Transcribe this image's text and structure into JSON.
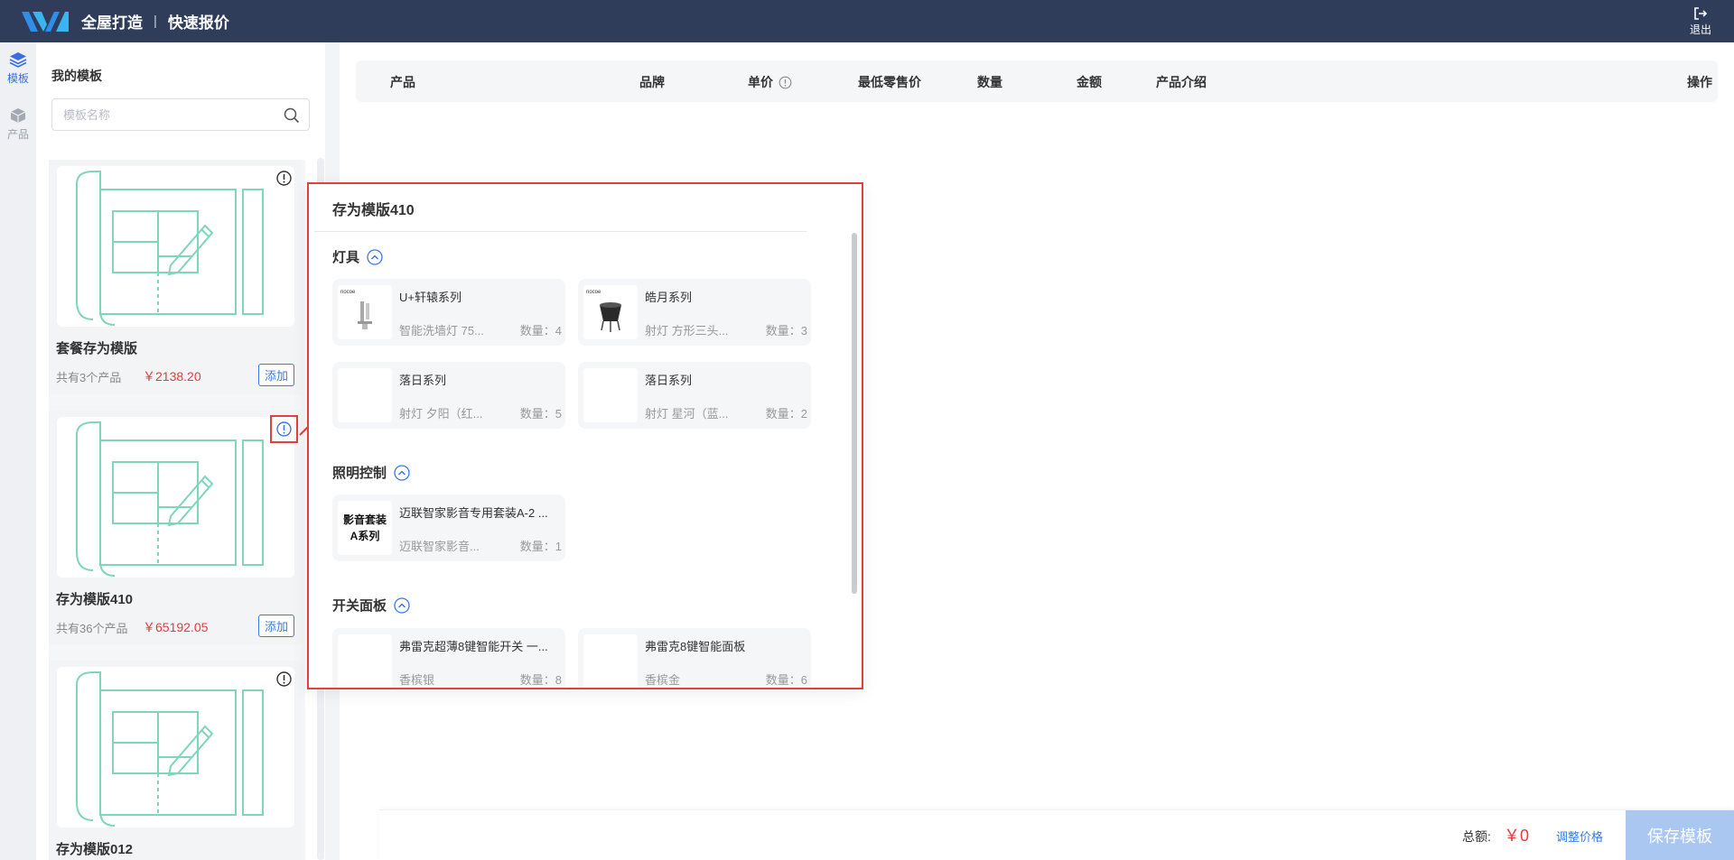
{
  "header": {
    "app_title": "全屋打造",
    "separator": "|",
    "subtitle": "快速报价",
    "logout_label": "退出"
  },
  "rail": {
    "items": [
      {
        "label": "模板",
        "icon": "layers-icon",
        "active": true
      },
      {
        "label": "产品",
        "icon": "box-icon",
        "active": false
      }
    ]
  },
  "templates": {
    "heading": "我的模板",
    "search_placeholder": "模板名称",
    "add_label": "添加",
    "items": [
      {
        "name": "套餐存为模版",
        "count": "共有3个产品",
        "price": "￥2138.20"
      },
      {
        "name": "存为模版410",
        "count": "共有36个产品",
        "price": "￥65192.05"
      },
      {
        "name": "存为模版012",
        "count": "",
        "price": ""
      }
    ]
  },
  "table": {
    "columns": [
      "产品",
      "品牌",
      "单价",
      "最低零售价",
      "数量",
      "金额",
      "产品介绍",
      "操作"
    ]
  },
  "footer": {
    "total_label": "总额:",
    "total_value": "￥0",
    "adjust_label": "调整价格",
    "save_label": "保存模板"
  },
  "popover": {
    "title": "存为模版410",
    "categories": [
      {
        "name": "灯具",
        "products": [
          {
            "name": "U+轩辕系列",
            "spec": "智能洗墙灯 75...",
            "qty": "数量：4",
            "image": "light-fixture"
          },
          {
            "name": "皓月系列",
            "spec": "射灯 方形三头...",
            "qty": "数量：3",
            "image": "black-spotlight"
          },
          {
            "name": "落日系列",
            "spec": "射灯 夕阳（红...",
            "qty": "数量：5",
            "image": "sunset"
          },
          {
            "name": "落日系列",
            "spec": "射灯 星河（蓝...",
            "qty": "数量：2",
            "image": "sunset"
          }
        ]
      },
      {
        "name": "照明控制",
        "products": [
          {
            "name": "迈联智家影音专用套装A-2 ...",
            "spec": "迈联智家影音...",
            "qty": "数量：1",
            "image": "text-card",
            "image_text": [
              "影音套装",
              "A系列"
            ]
          }
        ]
      },
      {
        "name": "开关面板",
        "products": [
          {
            "name": "弗雷克超薄8键智能开关 一...",
            "spec": "香槟银",
            "qty": "数量：8",
            "image": "silver"
          },
          {
            "name": "弗雷克8键智能面板",
            "spec": "香槟金",
            "qty": "数量：6",
            "image": "gold"
          }
        ]
      }
    ]
  },
  "colors": {
    "topbar": "#2f3d5a",
    "accent": "#3b7ae0",
    "price": "#e8393d",
    "highlight": "#e04040"
  }
}
